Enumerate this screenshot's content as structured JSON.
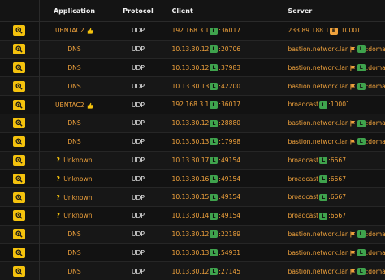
{
  "headers": {
    "application": "Application",
    "protocol": "Protocol",
    "client": "Client",
    "server": "Server"
  },
  "rows": [
    {
      "app": "UBNTAC2",
      "app_icon": "thumbs-up",
      "protocol": "UDP",
      "client_ip": "192.168.3.1",
      "client_badge": "L",
      "client_port": ":36017",
      "server_host": "233.89.188.1",
      "server_badge": "R",
      "server_port": ":10001",
      "server_flag": false
    },
    {
      "app": "DNS",
      "app_icon": "",
      "protocol": "UDP",
      "client_ip": "10.13.30.12",
      "client_badge": "L",
      "client_port": ":20706",
      "server_host": "bastion.network.lan",
      "server_badge": "L",
      "server_port": ":domain",
      "server_flag": true
    },
    {
      "app": "DNS",
      "app_icon": "",
      "protocol": "UDP",
      "client_ip": "10.13.30.12",
      "client_badge": "L",
      "client_port": ":37983",
      "server_host": "bastion.network.lan",
      "server_badge": "L",
      "server_port": ":domain",
      "server_flag": true
    },
    {
      "app": "DNS",
      "app_icon": "",
      "protocol": "UDP",
      "client_ip": "10.13.30.13",
      "client_badge": "L",
      "client_port": ":42200",
      "server_host": "bastion.network.lan",
      "server_badge": "L",
      "server_port": ":domain",
      "server_flag": true
    },
    {
      "app": "UBNTAC2",
      "app_icon": "thumbs-up",
      "protocol": "UDP",
      "client_ip": "192.168.3.1",
      "client_badge": "L",
      "client_port": ":36017",
      "server_host": "broadcast",
      "server_badge": "L",
      "server_port": ":10001",
      "server_flag": false
    },
    {
      "app": "DNS",
      "app_icon": "",
      "protocol": "UDP",
      "client_ip": "10.13.30.12",
      "client_badge": "L",
      "client_port": ":28880",
      "server_host": "bastion.network.lan",
      "server_badge": "L",
      "server_port": ":domain",
      "server_flag": true
    },
    {
      "app": "DNS",
      "app_icon": "",
      "protocol": "UDP",
      "client_ip": "10.13.30.13",
      "client_badge": "L",
      "client_port": ":17998",
      "server_host": "bastion.network.lan",
      "server_badge": "L",
      "server_port": ":domain",
      "server_flag": true
    },
    {
      "app": "Unknown",
      "app_icon": "question",
      "protocol": "UDP",
      "client_ip": "10.13.30.17",
      "client_badge": "L",
      "client_port": ":49154",
      "server_host": "broadcast",
      "server_badge": "L",
      "server_port": ":6667",
      "server_flag": false
    },
    {
      "app": "Unknown",
      "app_icon": "question",
      "protocol": "UDP",
      "client_ip": "10.13.30.16",
      "client_badge": "L",
      "client_port": ":49154",
      "server_host": "broadcast",
      "server_badge": "L",
      "server_port": ":6667",
      "server_flag": false
    },
    {
      "app": "Unknown",
      "app_icon": "question",
      "protocol": "UDP",
      "client_ip": "10.13.30.15",
      "client_badge": "L",
      "client_port": ":49154",
      "server_host": "broadcast",
      "server_badge": "L",
      "server_port": ":6667",
      "server_flag": false
    },
    {
      "app": "Unknown",
      "app_icon": "question",
      "protocol": "UDP",
      "client_ip": "10.13.30.14",
      "client_badge": "L",
      "client_port": ":49154",
      "server_host": "broadcast",
      "server_badge": "L",
      "server_port": ":6667",
      "server_flag": false
    },
    {
      "app": "DNS",
      "app_icon": "",
      "protocol": "UDP",
      "client_ip": "10.13.30.12",
      "client_badge": "L",
      "client_port": ":22189",
      "server_host": "bastion.network.lan",
      "server_badge": "L",
      "server_port": ":domain",
      "server_flag": true
    },
    {
      "app": "DNS",
      "app_icon": "",
      "protocol": "UDP",
      "client_ip": "10.13.30.13",
      "client_badge": "L",
      "client_port": ":54931",
      "server_host": "bastion.network.lan",
      "server_badge": "L",
      "server_port": ":domain",
      "server_flag": true
    },
    {
      "app": "DNS",
      "app_icon": "",
      "protocol": "UDP",
      "client_ip": "10.13.30.12",
      "client_badge": "L",
      "client_port": ":27145",
      "server_host": "bastion.network.lan",
      "server_badge": "L",
      "server_port": ":domain",
      "server_flag": true
    }
  ],
  "colors": {
    "accent": "#f4c20d",
    "link": "#f0a23c",
    "local_badge": "#3fa34d",
    "remote_badge": "#f0a23c",
    "background": "#0e0e0e"
  },
  "icons": {
    "details": "zoom-in-icon",
    "flag": "flag-icon",
    "thumbs_up": "thumbs-up-icon",
    "unknown": "question-mark-icon"
  }
}
